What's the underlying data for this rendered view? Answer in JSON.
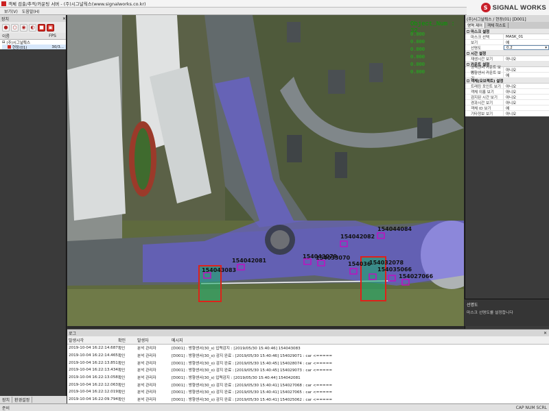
{
  "window": {
    "title": "객체 검출/추적/카운팅 서버 - (주)시그널웍스(www.signalworks.co.kr)",
    "brand": "SIGNAL WORKS"
  },
  "menubar": {
    "items": [
      "보기(V)",
      "도움말(H)"
    ]
  },
  "left_panel": {
    "title": "장치",
    "columns": [
      "이름",
      "FPS"
    ],
    "tree": [
      {
        "label": "(주)시그널웍스",
        "fps": ""
      },
      {
        "label": "현장(01)",
        "fps": "30/3..."
      }
    ],
    "tabs": [
      "장치",
      "환경설정"
    ]
  },
  "video": {
    "object_num_label": "Object_Num : 32",
    "status_lines": [
      "0.000",
      "0.000",
      "0.000",
      "0.000",
      "0.000",
      "0.000"
    ],
    "vehicle_ids": [
      "154044084",
      "154042082",
      "154042081",
      "154043083",
      "154043079",
      "154033070",
      "154036",
      "154032078",
      "154035066",
      "154027066"
    ]
  },
  "right_panel": {
    "title": "(주)시그널웍스 / 현장(01) [D001]",
    "tabs": [
      "영역 제어",
      "객체 히스토"
    ],
    "sections": [
      {
        "title": "마스크 설정",
        "rows": [
          {
            "k": "마스크 선택",
            "v": "MASK_01"
          },
          {
            "k": "보기",
            "v": "예"
          },
          {
            "k": "선명도",
            "v": "0.2",
            "selected": true
          }
        ]
      },
      {
        "title": "시간 설정",
        "rows": [
          {
            "k": "재생시간 보기",
            "v": "아니오"
          }
        ]
      },
      {
        "title": "카운트 설정",
        "rows": [
          {
            "k": "영역센서 카운트 보기",
            "v": "아니오"
          },
          {
            "k": "방향센서 카운트 보기",
            "v": "예"
          }
        ]
      },
      {
        "title": "객체(오브젝트) 설정",
        "rows": [
          {
            "k": "트래킹 포인트 보기",
            "v": "아니오"
          },
          {
            "k": "객체 이름 보기",
            "v": "아니오"
          },
          {
            "k": "검지된 시간 보기",
            "v": "아니오"
          },
          {
            "k": "경과시간 보기",
            "v": "아니오"
          },
          {
            "k": "객체 ID 보기",
            "v": "예"
          },
          {
            "k": "기타정보 보기",
            "v": "아니오"
          }
        ]
      }
    ],
    "description": {
      "heading": "선명도",
      "text": "마스크 선명도를 설정합니다"
    }
  },
  "log": {
    "title": "로그",
    "columns": [
      "발생시각",
      "확인",
      "발생자",
      "메시지"
    ],
    "rows": [
      {
        "time": "2019-10-04 16:22:14.687",
        "confirm": "확인",
        "by": "분석 관리자",
        "msg": "[D001] : 방향센서(30_s) 입력감지 : [2019/05/30 15:40:46] 154043083"
      },
      {
        "time": "2019-10-04 16:22:14.465",
        "confirm": "확인",
        "by": "분석 관리자",
        "msg": "[D001] : 방향센서(30_o) 감지 완료 : [2019/05/30 15:40:46] 154029071 : car <====="
      },
      {
        "time": "2019-10-04 16:22:13.851",
        "confirm": "확인",
        "by": "분석 관리자",
        "msg": "[D001] : 방향센서(30_o) 감지 완료 : [2019/05/30 15:40:45] 154028074 : car <====="
      },
      {
        "time": "2019-10-04 16:22:13.434",
        "confirm": "확인",
        "by": "분석 관리자",
        "msg": "[D001] : 방향센서(30_o) 감지 완료 : [2019/05/30 15:40:45] 154029073 : car <====="
      },
      {
        "time": "2019-10-04 16:22:13.058",
        "confirm": "확인",
        "by": "분석 관리자",
        "msg": "[D001] : 방향센서(30_s) 입력감지 : [2019/05/30 15:40:44] 154042081"
      },
      {
        "time": "2019-10-04 16:22:12.063",
        "confirm": "확인",
        "by": "분석 관리자",
        "msg": "[D001] : 방향센서(30_o) 감지 완료 : [2019/05/30 15:40:41] 154027068 : car <====="
      },
      {
        "time": "2019-10-04 16:22:12.019",
        "confirm": "확인",
        "by": "분석 관리자",
        "msg": "[D001] : 방향센서(30_o) 감지 완료 : [2019/05/30 15:40:41] 154027065 : car <====="
      },
      {
        "time": "2019-10-04 16:22:09.794",
        "confirm": "확인",
        "by": "분석 관리자",
        "msg": "[D001] : 방향센서(30_o) 감지 완료 : [2019/05/30 15:40:41] 154025062 : car <====="
      }
    ]
  },
  "statusbar": {
    "left": "준비",
    "right": "CAP NUM SCRL"
  },
  "colors": {
    "accent": "#c8202a",
    "overlay": "#6a5cff",
    "sensor_box": "#e0201a",
    "vehicle_box": "#c010c0",
    "osd_text": "#00a000"
  }
}
